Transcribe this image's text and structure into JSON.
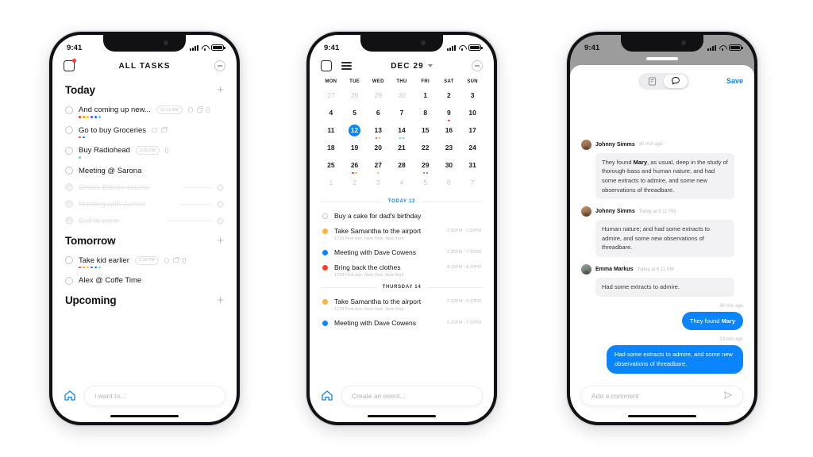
{
  "phones": {
    "tasks": {
      "statusbar": {
        "time": "9:41",
        "signal_icon": "cellular-bars-icon",
        "wifi_icon": "wifi-icon",
        "battery_icon": "battery-icon"
      },
      "header": {
        "menu_icon": "square-badge-icon",
        "title": "ALL TASKS",
        "collapse_icon": "circle-minus-icon"
      },
      "sections": [
        {
          "title": "Today",
          "add_label": "+",
          "tasks": [
            {
              "name": "And coming up new...",
              "time": "12:15 AM",
              "icons": [
                "circle-icon",
                "flag-icon",
                "doc-icon"
              ],
              "dots": [
                "#ff3b30",
                "#ff9f0a",
                "#ffd60a",
                "#5e5ce6",
                "#0a84ff",
                "#64d2ff"
              ],
              "done": false
            },
            {
              "name": "Go to buy Groceries",
              "time": "",
              "icons": [
                "circle-icon",
                "flag-icon"
              ],
              "dots": [
                "#ff3b30",
                "#0a84ff"
              ],
              "done": false
            },
            {
              "name": "Buy Radiohead",
              "time": "3:30 PM",
              "icons": [
                "doc-icon"
              ],
              "dots": [
                "#64d2ff"
              ],
              "done": false
            },
            {
              "name": "Meeting @ Sarona",
              "time": "",
              "icons": [],
              "dots": [],
              "done": false
            },
            {
              "name": "Check Bitcoin course",
              "time": "",
              "icons": [],
              "dots": [],
              "done": true
            },
            {
              "name": "Meeting with James",
              "time": "",
              "icons": [],
              "dots": [],
              "done": true
            },
            {
              "name": "Call to mom",
              "time": "",
              "icons": [],
              "dots": [],
              "done": true
            }
          ]
        },
        {
          "title": "Tomorrow",
          "add_label": "+",
          "tasks": [
            {
              "name": "Take kid earlier",
              "time": "3:30 PM",
              "icons": [
                "circle-icon",
                "flag-icon",
                "doc-icon"
              ],
              "dots": [
                "#ff3b30",
                "#ff9f0a",
                "#ffd60a",
                "#5e5ce6",
                "#0a84ff",
                "#64d2ff"
              ],
              "done": false
            },
            {
              "name": "Alex @ Coffe Time",
              "time": "",
              "icons": [],
              "dots": [],
              "done": false
            }
          ]
        },
        {
          "title": "Upcoming",
          "add_label": "+",
          "tasks": []
        }
      ],
      "bottom": {
        "home_icon": "home-icon",
        "input_placeholder": "I want to..."
      }
    },
    "calendar": {
      "statusbar": {
        "time": "9:41"
      },
      "header": {
        "square_icon": "square-icon",
        "list_icon": "hamburger-icon",
        "title": "DEC 29",
        "chevron_icon": "chevron-down-icon",
        "collapse_icon": "circle-minus-icon"
      },
      "weekday_labels": [
        "MON",
        "TUE",
        "WED",
        "THU",
        "FRI",
        "SAT",
        "SUN"
      ],
      "weeks": [
        [
          {
            "d": "27",
            "muted": true,
            "dots": []
          },
          {
            "d": "28",
            "muted": true,
            "dots": []
          },
          {
            "d": "29",
            "muted": true,
            "dots": []
          },
          {
            "d": "30",
            "muted": true,
            "dots": []
          },
          {
            "d": "1",
            "muted": false,
            "dots": []
          },
          {
            "d": "2",
            "muted": false,
            "dots": []
          },
          {
            "d": "3",
            "muted": false,
            "dots": []
          }
        ],
        [
          {
            "d": "4",
            "muted": false,
            "dots": []
          },
          {
            "d": "5",
            "muted": false,
            "dots": []
          },
          {
            "d": "6",
            "muted": false,
            "dots": []
          },
          {
            "d": "7",
            "muted": false,
            "dots": []
          },
          {
            "d": "8",
            "muted": false,
            "dots": []
          },
          {
            "d": "9",
            "muted": false,
            "dots": [
              "#ff3b30"
            ]
          },
          {
            "d": "10",
            "muted": false,
            "dots": []
          }
        ],
        [
          {
            "d": "11",
            "muted": false,
            "dots": []
          },
          {
            "d": "12",
            "muted": false,
            "today": true,
            "dots": []
          },
          {
            "d": "13",
            "muted": false,
            "dots": [
              "#ff3b30",
              "#ffb340"
            ]
          },
          {
            "d": "14",
            "muted": false,
            "dots": [
              "#30d5c8",
              "#30d5c8"
            ]
          },
          {
            "d": "15",
            "muted": false,
            "dots": []
          },
          {
            "d": "16",
            "muted": false,
            "dots": []
          },
          {
            "d": "17",
            "muted": false,
            "dots": []
          }
        ],
        [
          {
            "d": "18",
            "muted": false,
            "dots": []
          },
          {
            "d": "19",
            "muted": false,
            "dots": []
          },
          {
            "d": "20",
            "muted": false,
            "dots": []
          },
          {
            "d": "21",
            "muted": false,
            "dots": []
          },
          {
            "d": "22",
            "muted": false,
            "dots": []
          },
          {
            "d": "23",
            "muted": false,
            "dots": []
          },
          {
            "d": "24",
            "muted": false,
            "dots": []
          }
        ],
        [
          {
            "d": "25",
            "muted": false,
            "dots": []
          },
          {
            "d": "26",
            "muted": false,
            "dots": [
              "#ff3b30",
              "#ffb340"
            ]
          },
          {
            "d": "27",
            "muted": false,
            "dots": [
              "#ffb340"
            ]
          },
          {
            "d": "28",
            "muted": false,
            "dots": []
          },
          {
            "d": "29",
            "muted": false,
            "dots": [
              "#ff3b30",
              "#0a84ff"
            ]
          },
          {
            "d": "30",
            "muted": false,
            "dots": []
          },
          {
            "d": "31",
            "muted": false,
            "dots": []
          }
        ],
        [
          {
            "d": "1",
            "muted": true,
            "dots": []
          },
          {
            "d": "2",
            "muted": true,
            "dots": []
          },
          {
            "d": "3",
            "muted": true,
            "dots": []
          },
          {
            "d": "4",
            "muted": true,
            "dots": []
          },
          {
            "d": "5",
            "muted": true,
            "dots": []
          },
          {
            "d": "6",
            "muted": true,
            "dots": []
          },
          {
            "d": "7",
            "muted": true,
            "dots": []
          }
        ]
      ],
      "groups": [
        {
          "label": "TODAY 12",
          "is_today": true,
          "events": [
            {
              "title": "Buy a cake for dad's birthday",
              "sub": "",
              "time": "",
              "color": "hollow"
            },
            {
              "title": "Take Samantha to the airport",
              "sub": "1729 First ave, New York, New York",
              "time": "2:30PM - 3:30PM",
              "color": "#ffb340"
            },
            {
              "title": "Meeting with Dave Cowens",
              "sub": "",
              "time": "6:25PM - 7:32PM",
              "color": "#0a84ff"
            },
            {
              "title": "Bring back the clothes",
              "sub": "1729 First ave, New York, New York",
              "time": "8:15PM - 8:30PM",
              "color": "#ff3b30"
            }
          ]
        },
        {
          "label": "THURSDAY 14",
          "is_today": false,
          "events": [
            {
              "title": "Take Samantha to the airport",
              "sub": "1729 First ave, New York, New York",
              "time": "2:30PM - 3:30PM",
              "color": "#ffb340"
            },
            {
              "title": "Meeting with Dave Cowens",
              "sub": "",
              "time": "6:25PM - 7:32PM",
              "color": "#0a84ff"
            }
          ]
        }
      ],
      "bottom": {
        "home_icon": "home-icon",
        "input_placeholder": "Create an event..."
      }
    },
    "comments": {
      "statusbar": {
        "time": "9:41"
      },
      "header": {
        "notes_tab_icon": "note-icon",
        "comments_tab_icon": "comment-bubble-icon",
        "save_label": "Save"
      },
      "messages": [
        {
          "side": "left",
          "author": "Johnny Simms",
          "time": "30 min ago",
          "text_before": "They found ",
          "bold": "Mary",
          "text_after": ", as usual, deep in the study of thorough-bass and human nature; and had some extracts to admire, and some new observations of threadbare."
        },
        {
          "side": "left",
          "author": "Johnny Simms",
          "time": "Today at 6:11 PM",
          "text_before": "Human nature; and had some extracts to admire, and some new observations of threadbare.",
          "bold": "",
          "text_after": ""
        },
        {
          "side": "left",
          "author": "Emma Markus",
          "time": "Today at 6:11 PM",
          "text_before": "Had some extracts to admire.",
          "bold": "",
          "text_after": ""
        },
        {
          "side": "right",
          "author": "",
          "time": "30 min ago",
          "text_before": "They found ",
          "bold": "Mary",
          "text_after": ""
        },
        {
          "side": "right",
          "author": "",
          "time": "13 min ago",
          "text_before": "Had some extracts to admire, and some new observations of threadbare.",
          "bold": "",
          "text_after": ""
        }
      ],
      "bottom": {
        "input_placeholder": "Add a comment",
        "send_icon": "send-icon"
      }
    }
  }
}
